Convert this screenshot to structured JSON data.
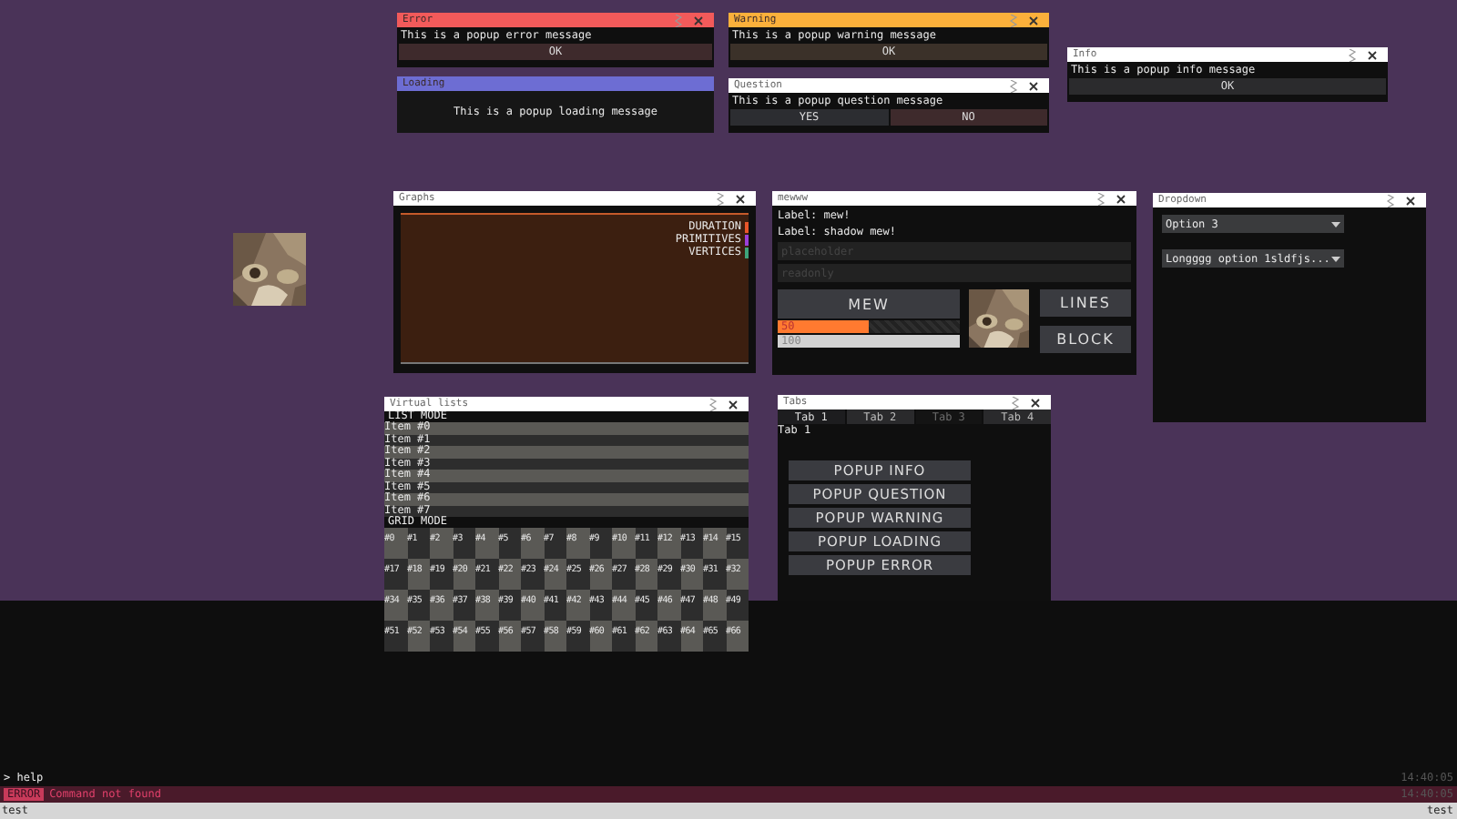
{
  "popups": [
    {
      "kind": "error",
      "title": "Error",
      "color": "#f25a5a",
      "closable": true,
      "message": "This is a popup error message",
      "buttons": [
        {
          "label": "OK",
          "color": "#3e2a2c"
        }
      ]
    },
    {
      "kind": "warning",
      "title": "Warning",
      "color": "#fbb03b",
      "closable": true,
      "message": "This is a popup warning message",
      "buttons": [
        {
          "label": "OK",
          "color": "#3b3129"
        }
      ]
    },
    {
      "kind": "info",
      "title": "Info",
      "color": "#ffffff",
      "closable": true,
      "message": "This is a popup info message",
      "buttons": [
        {
          "label": "OK",
          "color": "#2b2b2d"
        }
      ]
    },
    {
      "kind": "loading",
      "title": "Loading",
      "color": "#6d6dd3",
      "closable": false,
      "message": "This is a popup loading message"
    },
    {
      "kind": "question",
      "title": "Question",
      "color": "#ffffff",
      "closable": true,
      "message": "This is a popup question message",
      "buttons": [
        {
          "label": "YES",
          "color": "#2c2d31"
        },
        {
          "label": "NO",
          "color": "#3e2a2c"
        }
      ]
    }
  ],
  "graphs": {
    "title": "Graphs",
    "legend": [
      {
        "label": "DURATION",
        "color": "#e8562a"
      },
      {
        "label": "PRIMITIVES",
        "color": "#9b3fd8"
      },
      {
        "label": "VERTICES",
        "color": "#3ea37a"
      }
    ]
  },
  "widgets": {
    "title": "mewww",
    "labels": [
      "Label: mew!",
      "Label: shadow mew!"
    ],
    "input": {
      "placeholder": "placeholder"
    },
    "readonly_input": {
      "value": "readonly"
    },
    "mew_button": "MEW",
    "bars": [
      {
        "reading": "50",
        "level": 0.5,
        "color": "#ff7a30"
      },
      {
        "reading": "100",
        "level": 1,
        "color": "#d2d2d2"
      }
    ],
    "side_buttons": [
      "LINES",
      "BLOCK"
    ]
  },
  "dropdown": {
    "title": "Dropdown",
    "selects": [
      "Option 3",
      "Longggg option 1sldfjs..."
    ]
  },
  "virtual_lists": {
    "title": "Virtual lists",
    "list_heading": "LIST MODE",
    "items": [
      "Item #0",
      "Item #1",
      "Item #2",
      "Item #3",
      "Item #4",
      "Item #5",
      "Item #6",
      "Item #7"
    ],
    "grid_heading": "GRID MODE",
    "grid_rows": [
      [
        "#0",
        "#1",
        "#2",
        "#3",
        "#4",
        "#5",
        "#6",
        "#7",
        "#8",
        "#9",
        "#10",
        "#11",
        "#12",
        "#13",
        "#14",
        "#15"
      ],
      [
        "#17",
        "#18",
        "#19",
        "#20",
        "#21",
        "#22",
        "#23",
        "#24",
        "#25",
        "#26",
        "#27",
        "#28",
        "#29",
        "#30",
        "#31",
        "#32"
      ],
      [
        "#34",
        "#35",
        "#36",
        "#37",
        "#38",
        "#39",
        "#40",
        "#41",
        "#42",
        "#43",
        "#44",
        "#45",
        "#46",
        "#47",
        "#48",
        "#49"
      ],
      [
        "#51",
        "#52",
        "#53",
        "#54",
        "#55",
        "#56",
        "#57",
        "#58",
        "#59",
        "#60",
        "#61",
        "#62",
        "#63",
        "#64",
        "#65",
        "#66"
      ]
    ]
  },
  "tabs_window": {
    "title": "Tabs",
    "tabs": [
      {
        "label": "Tab 1",
        "selected": true,
        "disabled": false
      },
      {
        "label": "Tab 2",
        "selected": false,
        "disabled": false
      },
      {
        "label": "Tab 3",
        "selected": false,
        "disabled": true
      },
      {
        "label": "Tab 4",
        "selected": false,
        "disabled": false
      }
    ],
    "content": "Tab 1",
    "buttons": [
      "POPUP INFO",
      "POPUP QUESTION",
      "POPUP WARNING",
      "POPUP LOADING",
      "POPUP ERROR"
    ]
  },
  "console": {
    "lines": [
      {
        "kind": "input",
        "text": "> help",
        "time": "14:40:05"
      },
      {
        "kind": "error",
        "badge": "ERROR",
        "text": "Command not found",
        "time": "14:40:05"
      }
    ],
    "input": {
      "value": "test"
    },
    "right_text": "test"
  }
}
